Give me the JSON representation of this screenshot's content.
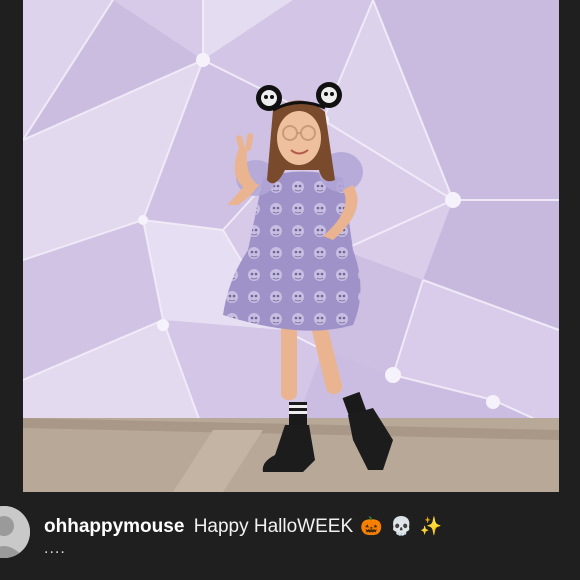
{
  "post": {
    "image_alt": "Girl in purple Halloween dress with mouse ears posing against a geometric lavender wall"
  },
  "caption": {
    "username": "ohhappymouse",
    "text": "Happy HalloWEEK",
    "emoji_pumpkin": "🎃",
    "emoji_skull": "💀",
    "emoji_sparkles": "✨",
    "more": "...."
  },
  "colors": {
    "background": "#1f1f1f",
    "wall_lavender": "#d7cbe8",
    "ground": "#b9aa9a"
  }
}
